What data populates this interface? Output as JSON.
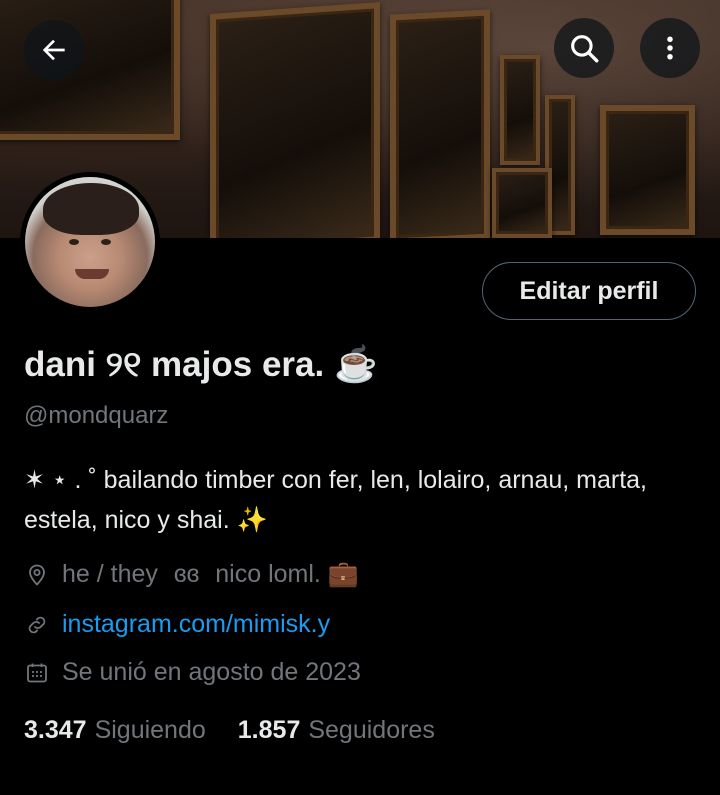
{
  "profile": {
    "display_name": "dani ୨୧ majos era. ☕",
    "handle": "@mondquarz",
    "bio": "✶ ⋆ . ˚ bailando timber con fer, len, lolairo, arnau, marta, estela, nico y shai. ✨",
    "location": "he / they",
    "location_extra": "ɞɞ",
    "location_extra2": "nico loml. 💼",
    "website": "instagram.com/mimisk.y",
    "joined": "Se unió en agosto de 2023"
  },
  "actions": {
    "edit_profile_label": "Editar perfil"
  },
  "stats": {
    "following_count": "3.347",
    "following_label": "Siguiendo",
    "followers_count": "1.857",
    "followers_label": "Seguidores"
  },
  "icons": {
    "back": "arrow-left-icon",
    "search": "search-icon",
    "more": "more-vertical-icon",
    "location": "location-pin-icon",
    "link": "link-icon",
    "calendar": "calendar-icon"
  },
  "colors": {
    "background": "#000000",
    "text_primary": "#e7e9ea",
    "text_secondary": "#71767b",
    "link": "#1d9bf0",
    "button_border": "#536471"
  }
}
